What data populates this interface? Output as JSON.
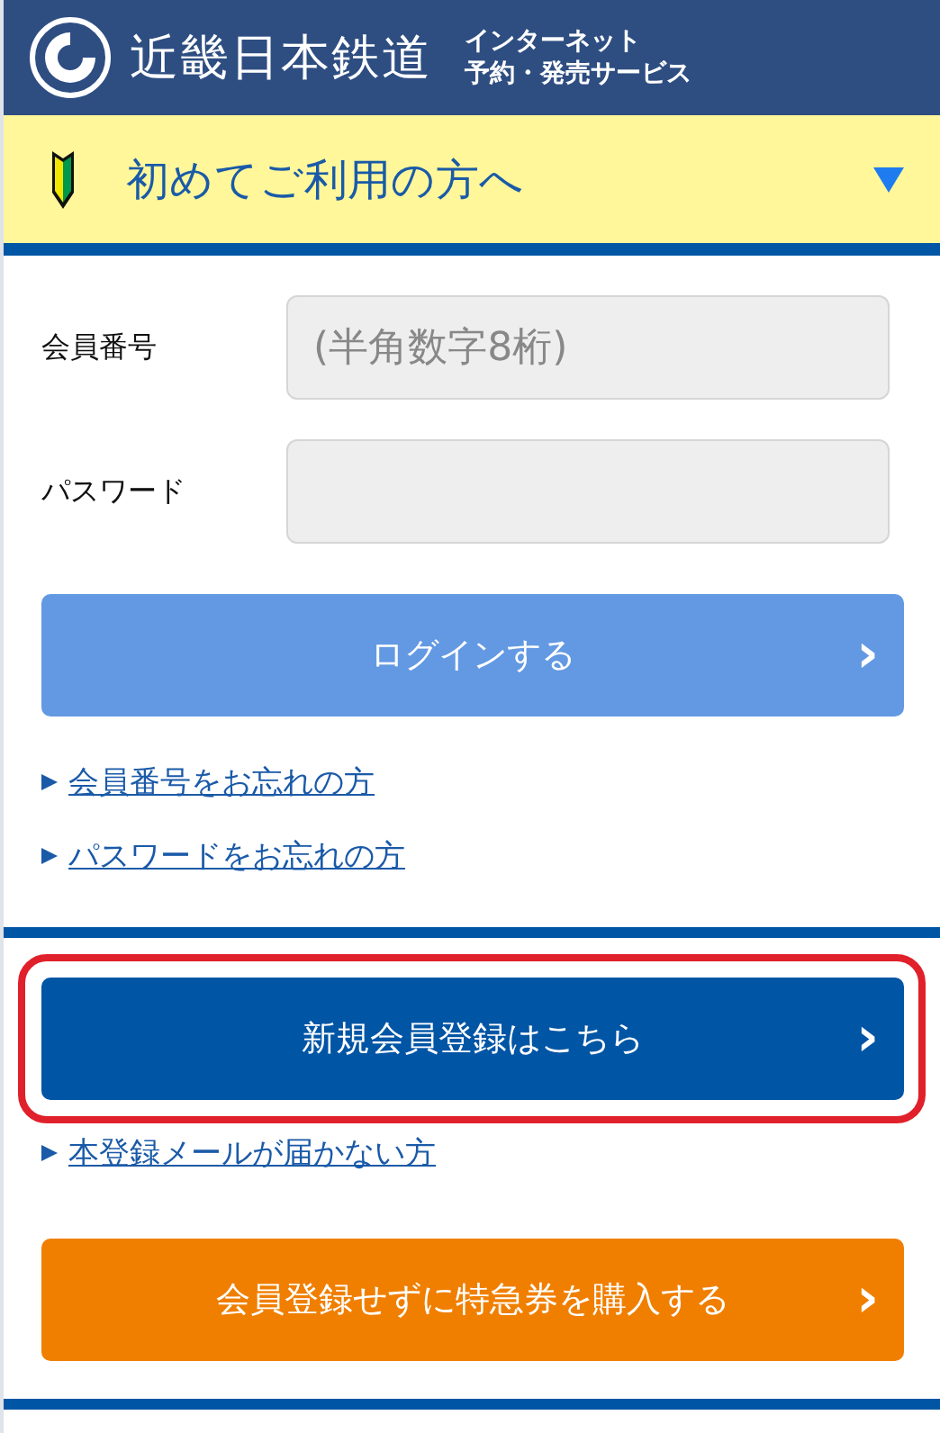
{
  "header": {
    "logo_text": "近畿日本鉄道",
    "service_line_1": "インターネット",
    "service_line_2": "予約・発売サービス"
  },
  "beginner_banner": {
    "label": "初めてご利用の方へ",
    "expanded": false
  },
  "login_form": {
    "fields": [
      {
        "label": "会員番号",
        "placeholder": "(半角数字8桁)"
      },
      {
        "label": "パスワード"
      }
    ],
    "login_button": {
      "label": "ログインする",
      "chevron": "›"
    },
    "links": [
      "会員番号をお忘れの方",
      "パスワードをお忘れの方"
    ]
  },
  "register": {
    "button": {
      "label": "新規会員登録はこちら",
      "chevron": "›",
      "highlighted": true
    },
    "links": [
      "本登録メールが届かない方"
    ]
  },
  "guest": {
    "button": {
      "label": "会員登録せずに特急券を購入する",
      "chevron": "›"
    }
  }
}
